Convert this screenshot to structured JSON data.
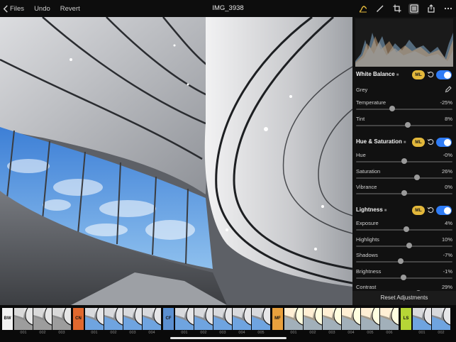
{
  "toolbar": {
    "back_label": "Files",
    "undo_label": "Undo",
    "revert_label": "Revert",
    "title": "IMG_3938",
    "icons": [
      "adjust-icon",
      "brush-icon",
      "crop-icon",
      "sliders-icon",
      "share-icon",
      "more-icon"
    ]
  },
  "panel": {
    "white_balance": {
      "title": "White Balance",
      "ml": "ML",
      "grey_label": "Grey",
      "rows": [
        {
          "label": "Temperature",
          "value": "-25%",
          "level": -0.25
        },
        {
          "label": "Tint",
          "value": "8%",
          "level": 0.08
        }
      ]
    },
    "hue_saturation": {
      "title": "Hue & Saturation",
      "ml": "ML",
      "rows": [
        {
          "label": "Hue",
          "value": "-0%",
          "level": 0.0
        },
        {
          "label": "Saturation",
          "value": "26%",
          "level": 0.26
        },
        {
          "label": "Vibrance",
          "value": "0%",
          "level": 0.0
        }
      ]
    },
    "lightness": {
      "title": "Lightness",
      "ml": "ML",
      "rows": [
        {
          "label": "Exposure",
          "value": "4%",
          "level": 0.04
        },
        {
          "label": "Highlights",
          "value": "10%",
          "level": 0.1
        },
        {
          "label": "Shadows",
          "value": "-7%",
          "level": -0.07
        },
        {
          "label": "Brightness",
          "value": "-1%",
          "level": -0.01
        },
        {
          "label": "Contrast",
          "value": "29%",
          "level": 0.29
        }
      ]
    },
    "reset_label": "Reset Adjustments"
  },
  "filmstrip": {
    "groups": [
      {
        "tag": "BW",
        "color": "#f2f2f2",
        "items": [
          "001",
          "002",
          "003"
        ]
      },
      {
        "tag": "CN",
        "color": "#e0682e",
        "items": [
          "001",
          "002",
          "003",
          "004"
        ]
      },
      {
        "tag": "CF",
        "color": "#5b8fd0",
        "items": [
          "001",
          "002",
          "003",
          "004",
          "005"
        ]
      },
      {
        "tag": "MF",
        "color": "#e8a03d",
        "items": [
          "001",
          "002",
          "003",
          "004",
          "005",
          "006"
        ]
      },
      {
        "tag": "LS",
        "color": "#b6d636",
        "items": [
          "001",
          "002"
        ]
      }
    ]
  },
  "colors": {
    "accent": "#2f7cf6",
    "ml_badge": "#e3b83b",
    "panel_bg": "#111111"
  }
}
